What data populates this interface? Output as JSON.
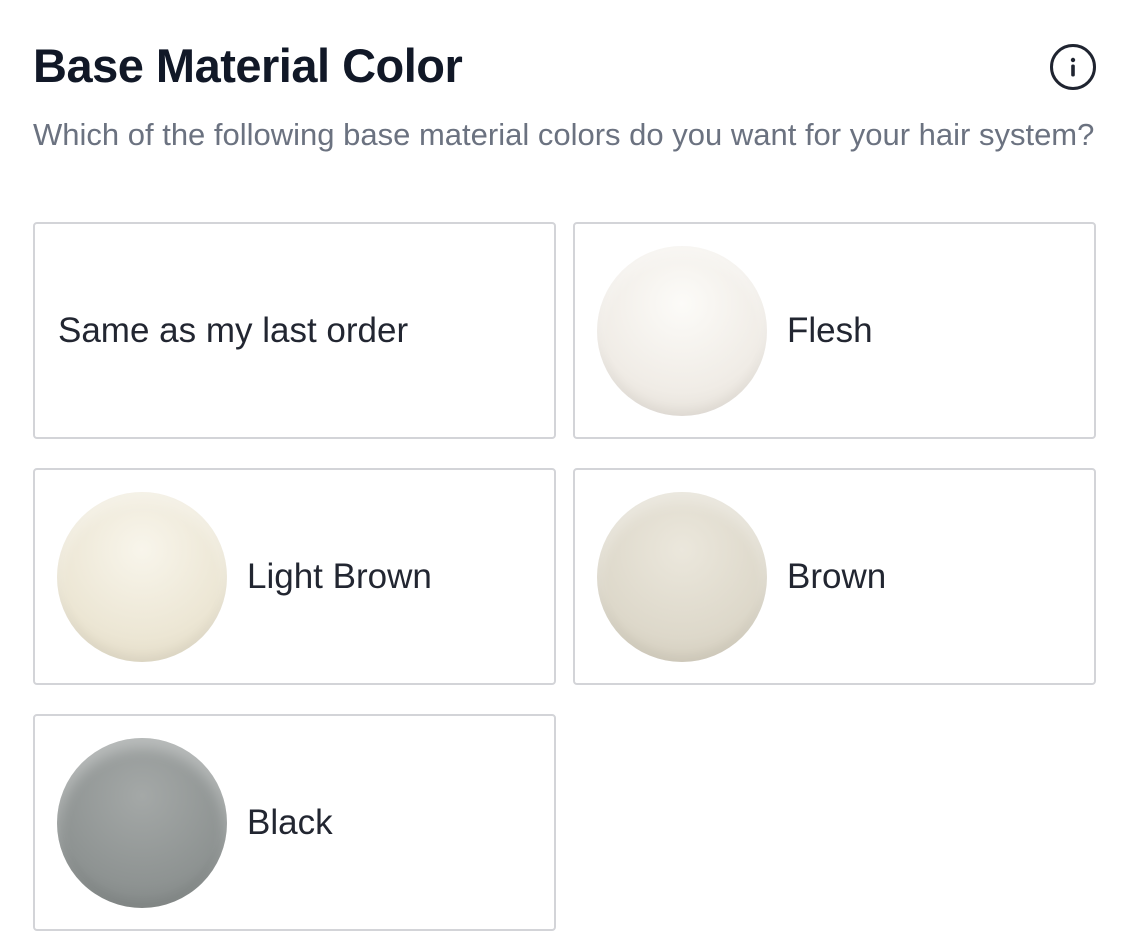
{
  "section": {
    "title": "Base Material Color",
    "info_icon": "info-icon",
    "question": "Which of the following base material colors do you want for your hair system?"
  },
  "options": [
    {
      "label": "Same as my last order",
      "swatch": null
    },
    {
      "label": "Flesh",
      "swatch": {
        "highlight": "#fcfbf8",
        "base": "#f0ece6",
        "edge": "#dcd6cd"
      }
    },
    {
      "label": "Light Brown",
      "swatch": {
        "highlight": "#f8f5eb",
        "base": "#ece6d4",
        "edge": "#d9d1bb"
      }
    },
    {
      "label": "Brown",
      "swatch": {
        "highlight": "#ebe7dc",
        "base": "#ddd8ca",
        "edge": "#c9c2b1"
      }
    },
    {
      "label": "Black",
      "swatch": {
        "highlight": "#a4a8a7",
        "base": "#8e9392",
        "edge": "#767b7a"
      }
    }
  ],
  "colors": {
    "title": "#111827",
    "subtitle": "#6b7280",
    "card_border": "#d3d4d8",
    "label": "#222631"
  }
}
